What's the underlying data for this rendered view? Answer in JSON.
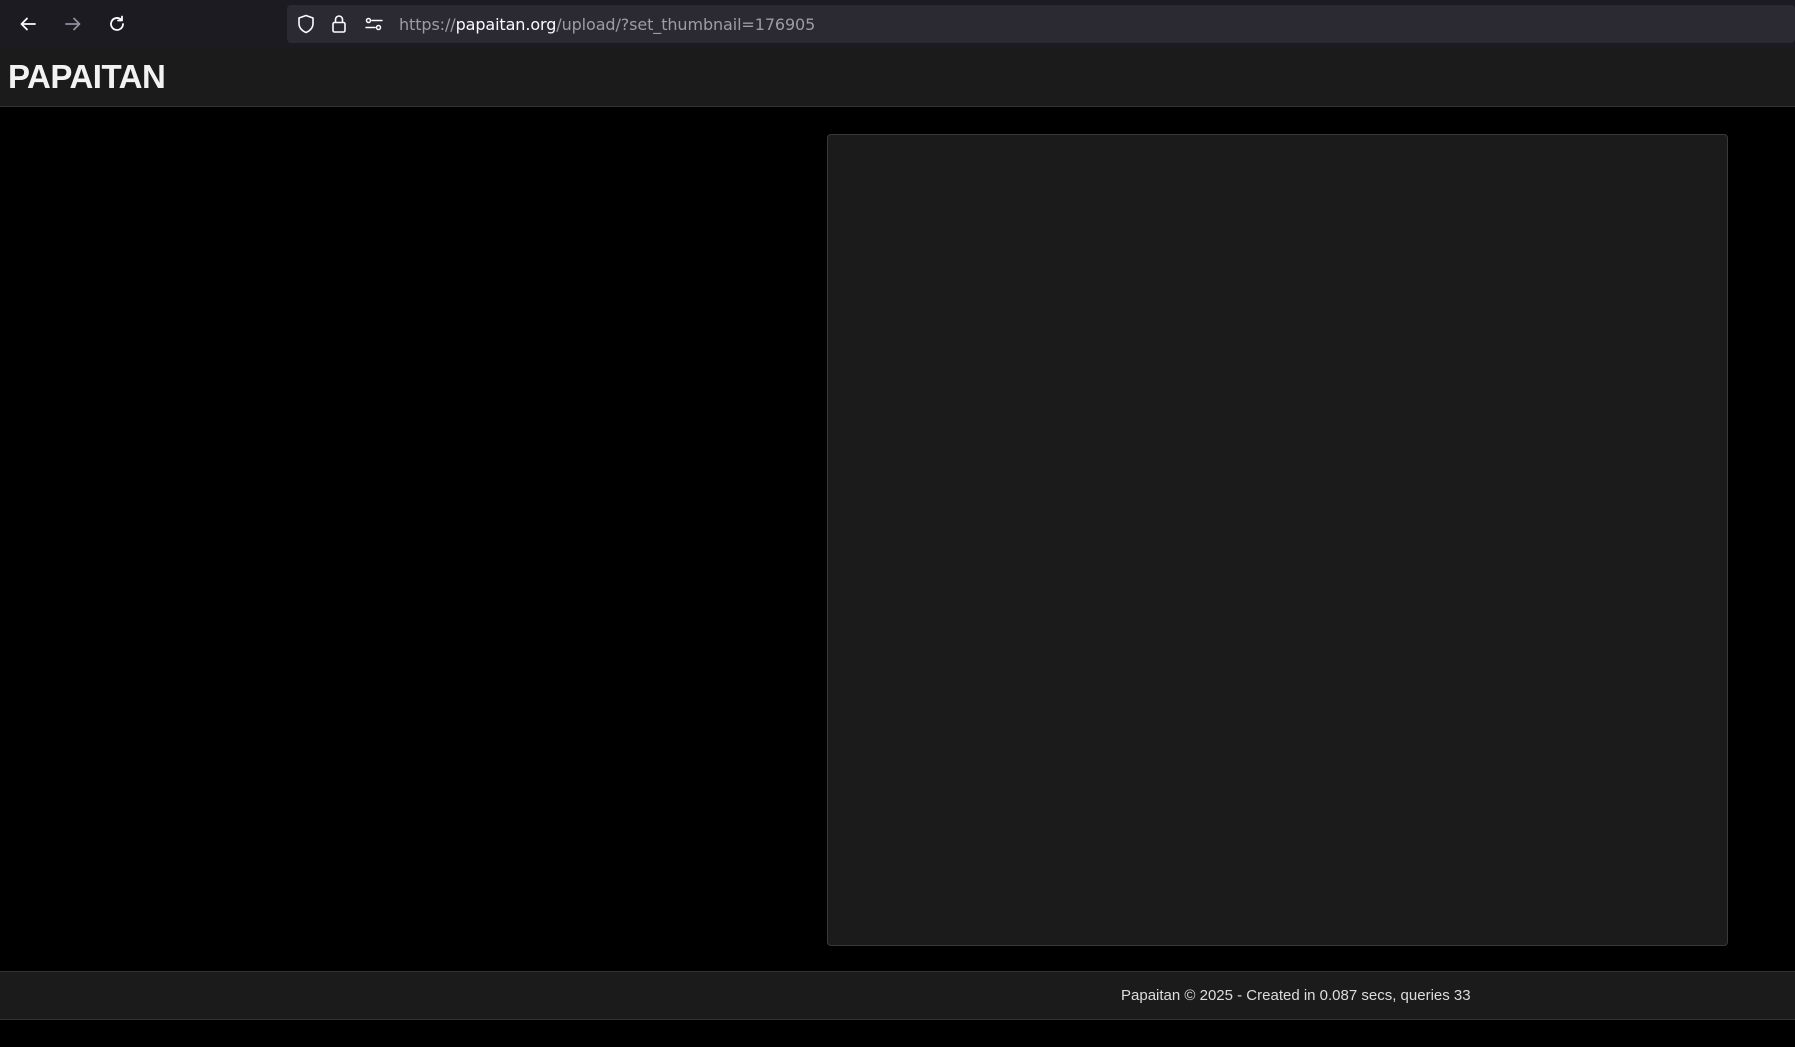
{
  "browser": {
    "back_icon": "arrow-left-icon",
    "forward_icon": "arrow-right-icon",
    "reload_icon": "reload-icon",
    "tracking_icon": "shield-icon",
    "lock_icon": "lock-icon",
    "permissions_icon": "sliders-icon",
    "url": {
      "scheme": "https://",
      "domain": "papaitan.org",
      "path": "/upload/?set_thumbnail=176905"
    }
  },
  "header": {
    "logo": "PAPAITAN"
  },
  "footer": {
    "text": "Papaitan © 2025 - Created in 0.087 secs, queries 33"
  },
  "colors": {
    "page_background": "#000000",
    "panel_background": "#1b1b1b",
    "browser_chrome": "#1c1b22",
    "url_field": "#2b2a33"
  }
}
